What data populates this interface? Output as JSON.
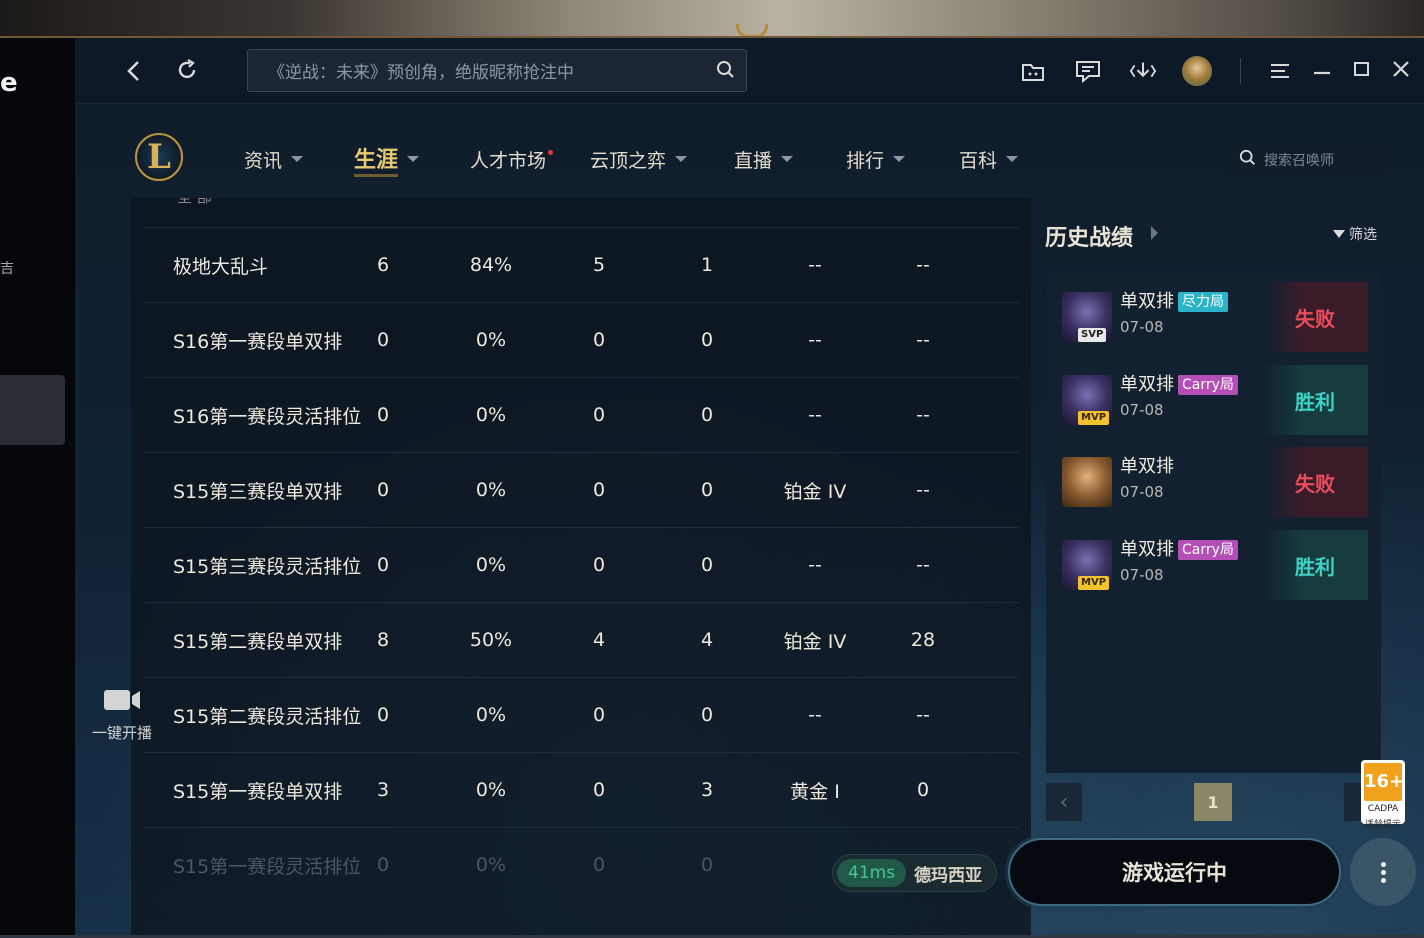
{
  "left_fragment": {
    "letter": "e",
    "mark": "吉"
  },
  "titlebar": {
    "search_placeholder": "《逆战：未来》预创角，绝版昵称抢注中"
  },
  "nav": {
    "items": [
      {
        "label": "资讯"
      },
      {
        "label": "生涯"
      },
      {
        "label": "人才市场"
      },
      {
        "label": "云顶之弈"
      },
      {
        "label": "直播"
      },
      {
        "label": "排行"
      },
      {
        "label": "百科"
      }
    ],
    "summoner_search_placeholder": "搜索召唤师"
  },
  "stats": {
    "partial_top": "全  部",
    "rows": [
      {
        "name": "极地大乱斗",
        "games": "6",
        "winrate": "84%",
        "wins": "5",
        "losses": "1",
        "tier": "--",
        "points": "--"
      },
      {
        "name": "S16第一赛段单双排",
        "games": "0",
        "winrate": "0%",
        "wins": "0",
        "losses": "0",
        "tier": "--",
        "points": "--"
      },
      {
        "name": "S16第一赛段灵活排位",
        "games": "0",
        "winrate": "0%",
        "wins": "0",
        "losses": "0",
        "tier": "--",
        "points": "--"
      },
      {
        "name": "S15第三赛段单双排",
        "games": "0",
        "winrate": "0%",
        "wins": "0",
        "losses": "0",
        "tier": "铂金 IV",
        "points": "--"
      },
      {
        "name": "S15第三赛段灵活排位",
        "games": "0",
        "winrate": "0%",
        "wins": "0",
        "losses": "0",
        "tier": "--",
        "points": "--"
      },
      {
        "name": "S15第二赛段单双排",
        "games": "8",
        "winrate": "50%",
        "wins": "4",
        "losses": "4",
        "tier": "铂金 IV",
        "points": "28"
      },
      {
        "name": "S15第二赛段灵活排位",
        "games": "0",
        "winrate": "0%",
        "wins": "0",
        "losses": "0",
        "tier": "--",
        "points": "--"
      },
      {
        "name": "S15第一赛段单双排",
        "games": "3",
        "winrate": "0%",
        "wins": "0",
        "losses": "3",
        "tier": "黄金 I",
        "points": "0"
      },
      {
        "name": "S15第一赛段灵活排位",
        "games": "0",
        "winrate": "0%",
        "wins": "0",
        "losses": "0",
        "tier": "",
        "points": ""
      }
    ]
  },
  "live_button": {
    "label": "一键开播"
  },
  "history": {
    "title": "历史战绩",
    "filter_label": "筛选",
    "matches": [
      {
        "mode": "单双排",
        "tag": "尽力局",
        "date": "07-08",
        "result": "失败",
        "badge": "SVP"
      },
      {
        "mode": "单双排",
        "tag": "Carry局",
        "date": "07-08",
        "result": "胜利",
        "badge": "MVP"
      },
      {
        "mode": "单双排",
        "tag": "",
        "date": "07-08",
        "result": "失败",
        "badge": ""
      },
      {
        "mode": "单双排",
        "tag": "Carry局",
        "date": "07-08",
        "result": "胜利",
        "badge": "MVP"
      }
    ],
    "pager": {
      "prev": "‹",
      "current_page": "1"
    }
  },
  "age_rating": {
    "number": "16+",
    "label": "适龄提示",
    "sub": "CADPA"
  },
  "status": {
    "ping": "41ms",
    "server": "德玛西亚"
  },
  "play_button": {
    "label": "游戏运行中"
  },
  "colors": {
    "accent_gold": "#e7c873",
    "lose_red": "#ea4d5c",
    "win_teal": "#3dd2c6",
    "tag_effort": "#2bb3c7",
    "tag_carry": "#b44fb8"
  },
  "icons": {
    "titlebar": [
      "back-icon",
      "refresh-icon",
      "search-icon",
      "box-icon",
      "chat-icon",
      "download-icon",
      "menu-icon",
      "minimize-icon",
      "maximize-icon",
      "close-icon"
    ]
  }
}
